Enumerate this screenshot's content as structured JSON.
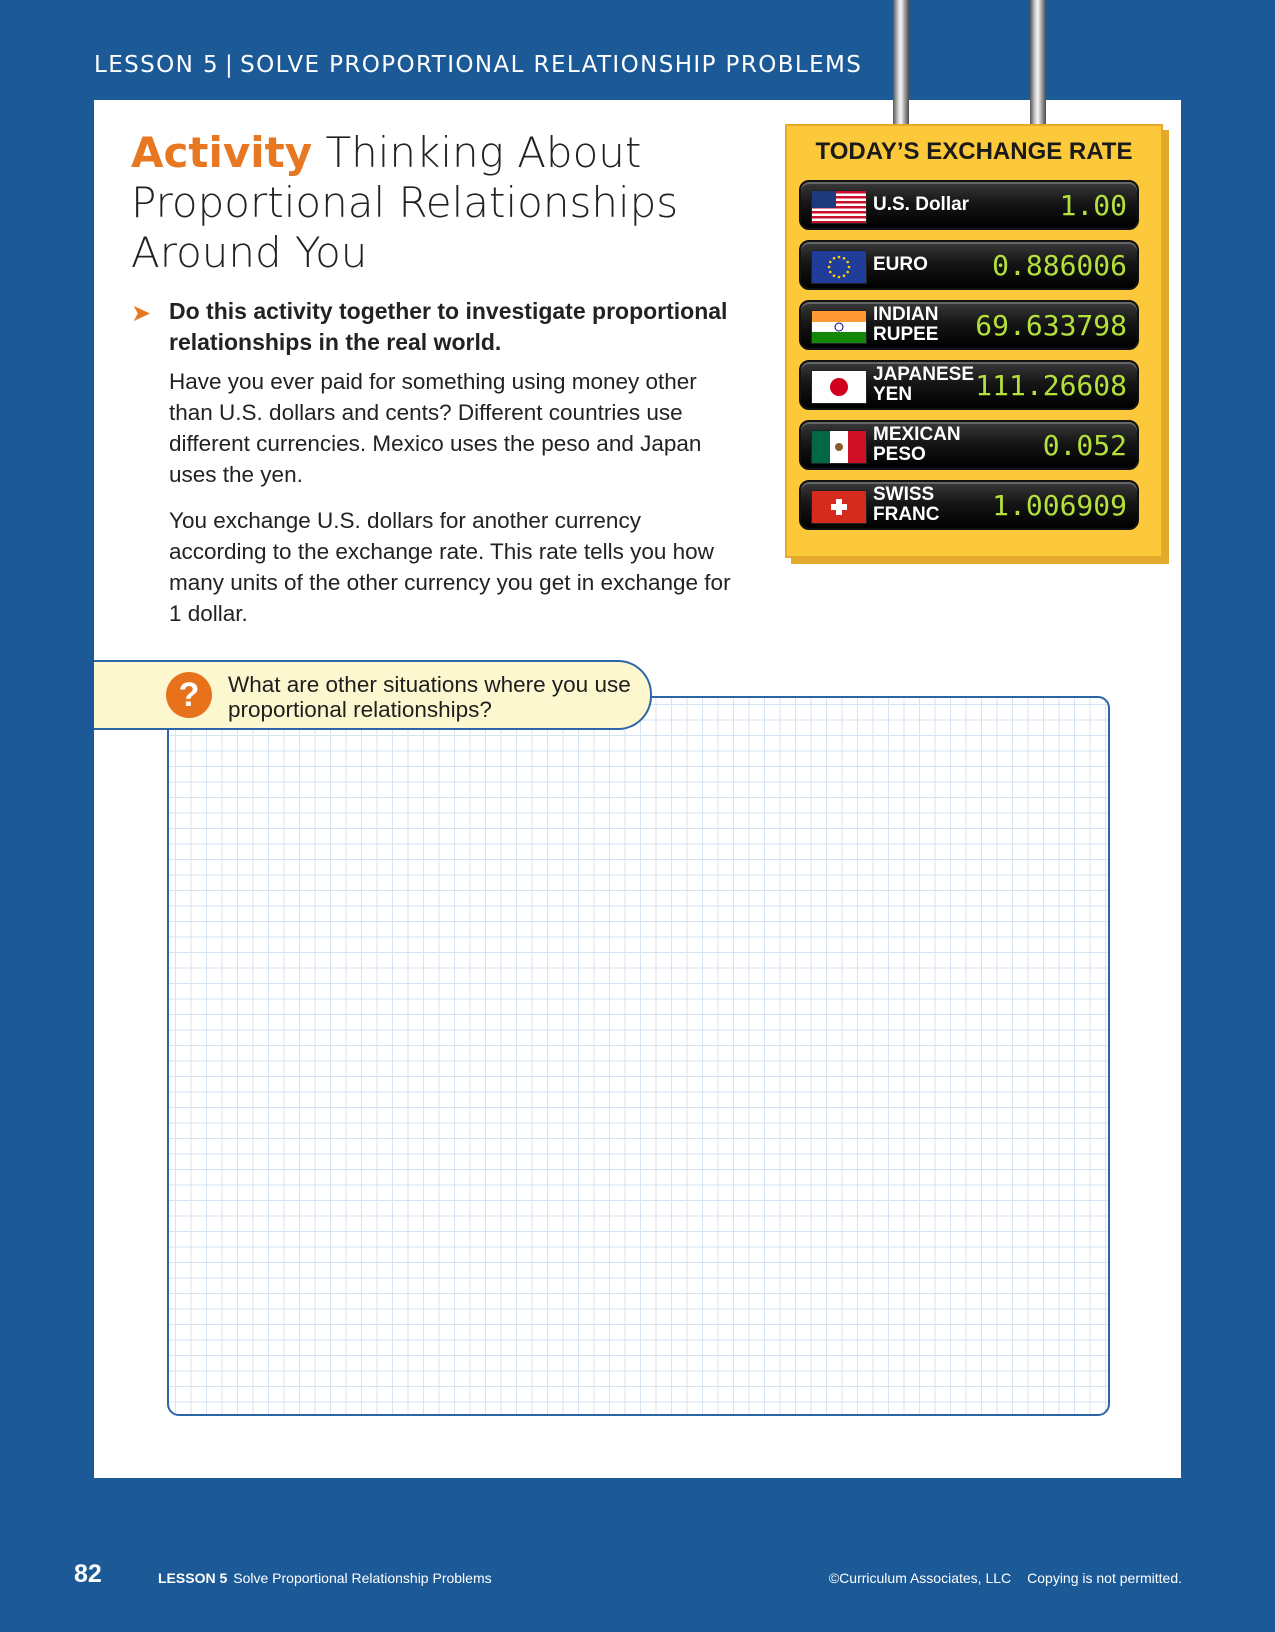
{
  "header": {
    "lesson": "LESSON 5",
    "title": "SOLVE PROPORTIONAL RELATIONSHIP PROBLEMS"
  },
  "activity": {
    "label": "Activity",
    "title": "Thinking About Proportional Relationships Around You",
    "instruction": "Do this activity together to investigate proportional relationships in the real world.",
    "paragraph1": "Have you ever paid for something using money other than U.S. dollars and cents? Different countries use different currencies. Mexico uses the peso and Japan uses the yen.",
    "paragraph2": "You exchange U.S. dollars for another currency according to the exchange rate. This rate tells you how many units of the other currency you get in exchange for 1 dollar."
  },
  "exchange_board": {
    "title": "TODAY’S EXCHANGE RATE",
    "rates": [
      {
        "name": "U.S. Dollar",
        "value": "1.00",
        "flag": "us-flag-icon"
      },
      {
        "name": "EURO",
        "value": "0.886006",
        "flag": "eu-flag-icon"
      },
      {
        "name": "INDIAN RUPEE",
        "value": "69.633798",
        "flag": "india-flag-icon"
      },
      {
        "name": "JAPANESE YEN",
        "value": "111.26608",
        "flag": "japan-flag-icon"
      },
      {
        "name": "MEXICAN PESO",
        "value": "0.052",
        "flag": "mexico-flag-icon"
      },
      {
        "name": "SWISS FRANC",
        "value": "1.006909",
        "flag": "swiss-flag-icon"
      }
    ]
  },
  "question": {
    "icon": "?",
    "text": "What are other situations where you use proportional relationships?"
  },
  "footer": {
    "page_number": "82",
    "lesson_label": "LESSON 5",
    "lesson_title": "Solve Proportional Relationship Problems",
    "copyright": "©Curriculum Associates, LLC",
    "notice": "Copying is not permitted."
  },
  "colors": {
    "background": "#1c5a97",
    "accent": "#e87722",
    "board": "#fcc93a",
    "display_digits": "#b3e03a"
  }
}
